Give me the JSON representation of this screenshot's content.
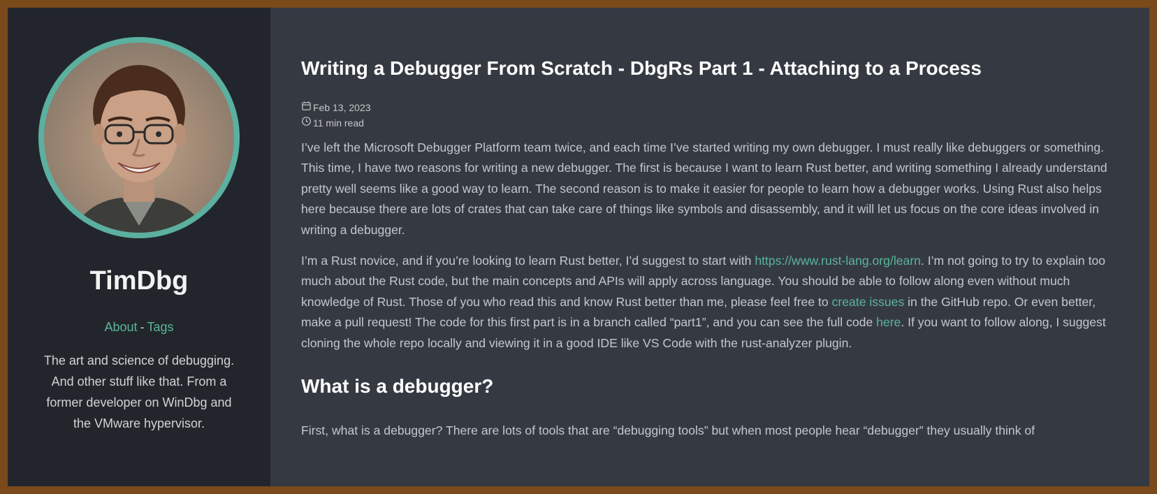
{
  "sidebar": {
    "site_title": "TimDbg",
    "nav": {
      "about": "About",
      "separator": "-",
      "tags": "Tags"
    },
    "description": "The art and science of debugging. And other stuff like that. From a former developer on WinDbg and the VMware hypervisor."
  },
  "post": {
    "title": "Writing a Debugger From Scratch - DbgRs Part 1 - Attaching to a Process",
    "date": "Feb 13, 2023",
    "read_time": "11 min read",
    "p1": "I’ve left the Microsoft Debugger Platform team twice, and each time I’ve started writing my own debugger. I must really like debuggers or something. This time, I have two reasons for writing a new debugger. The first is because I want to learn Rust better, and writing something I already understand pretty well seems like a good way to learn. The second reason is to make it easier for people to learn how a debugger works. Using Rust also helps here because there are lots of crates that can take care of things like symbols and disassembly, and it will let us focus on the core ideas involved in writing a debugger.",
    "p2": {
      "t1": "I’m a Rust novice, and if you’re looking to learn Rust better, I’d suggest to start with ",
      "link1": "https://www.rust-lang.org/learn",
      "t2": ". I’m not going to try to explain too much about the Rust code, but the main concepts and APIs will apply across language. You should be able to follow along even without much knowledge of Rust. Those of you who read this and know Rust better than me, please feel free to ",
      "link2": "create issues",
      "t3": " in the GitHub repo. Or even better, make a pull request! The code for this first part is in a branch called “part1”, and you can see the full code ",
      "link3": "here",
      "t4": ". If you want to follow along, I suggest cloning the whole repo locally and viewing it in a good IDE like VS Code with the rust-analyzer plugin."
    },
    "h2": "What is a debugger?",
    "p3": "First, what is a debugger? There are lots of tools that are “debugging tools” but when most people hear “debugger” they usually think of"
  },
  "icons": {
    "date": "calendar-icon",
    "read_time": "clock-icon"
  },
  "colors": {
    "accent": "#5bb59a",
    "sidebar_bg": "#22262c",
    "main_bg": "#353a42",
    "frame": "#7a4a1a",
    "avatar_ring": "#5bb0a0"
  }
}
